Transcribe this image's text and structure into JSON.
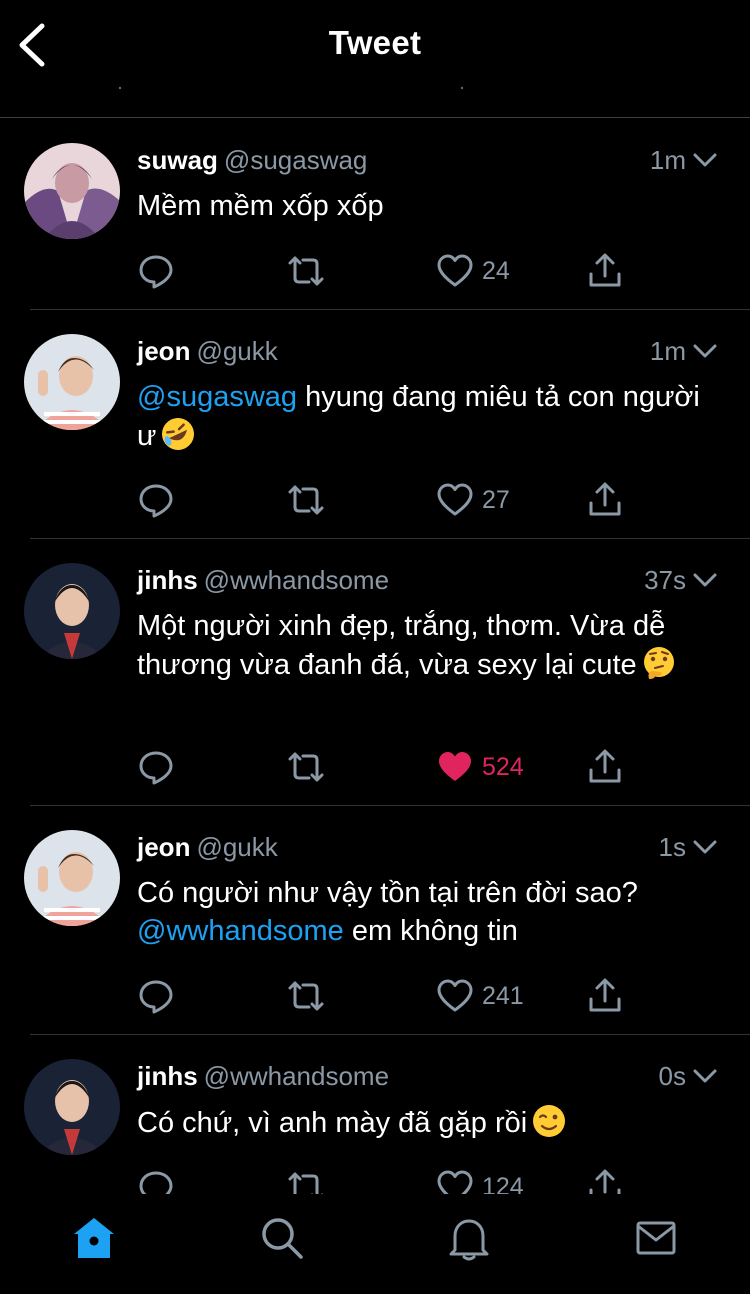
{
  "header": {
    "title": "Tweet"
  },
  "tweets": [
    {
      "name": "suwag",
      "handle": "@sugaswag",
      "time": "1m",
      "text": [
        "Mềm mềm xốp xốp"
      ],
      "mention": "",
      "emoji": "",
      "likes": "24",
      "liked": false
    },
    {
      "name": "jeon",
      "handle": "@gukk",
      "time": "1m",
      "mention": "@sugaswag",
      "text_after_mention": " hyung đang miêu tả con người ư",
      "emoji": "rolling-laughing-emoji",
      "likes": "27",
      "liked": false
    },
    {
      "name": "jinhs",
      "handle": "@wwhandsome",
      "time": "37s",
      "text": "Một người xinh đẹp, trắng, thơm. Vừa dễ thương vừa đanh đá, vừa sexy lại cute",
      "emoji": "thinking-face-emoji",
      "likes": "524",
      "liked": true
    },
    {
      "name": "jeon",
      "handle": "@gukk",
      "time": "1s",
      "text_before_mention": "Có người như vậy tồn tại trên đời sao?",
      "mention": "@wwhandsome",
      "text_after_mention": " em không tin",
      "likes": "241",
      "liked": false
    },
    {
      "name": "jinhs",
      "handle": "@wwhandsome",
      "time": "0s",
      "text": "Có chứ, vì anh mày đã gặp rồi",
      "emoji": "winking-face-emoji",
      "likes": "124",
      "liked": false
    }
  ],
  "tabs": [
    "home-icon",
    "search-icon",
    "notifications-icon",
    "messages-icon"
  ],
  "colors": {
    "accent": "#1da1f2",
    "like": "#e0245e",
    "muted": "#8b98a5",
    "background": "#000000"
  }
}
